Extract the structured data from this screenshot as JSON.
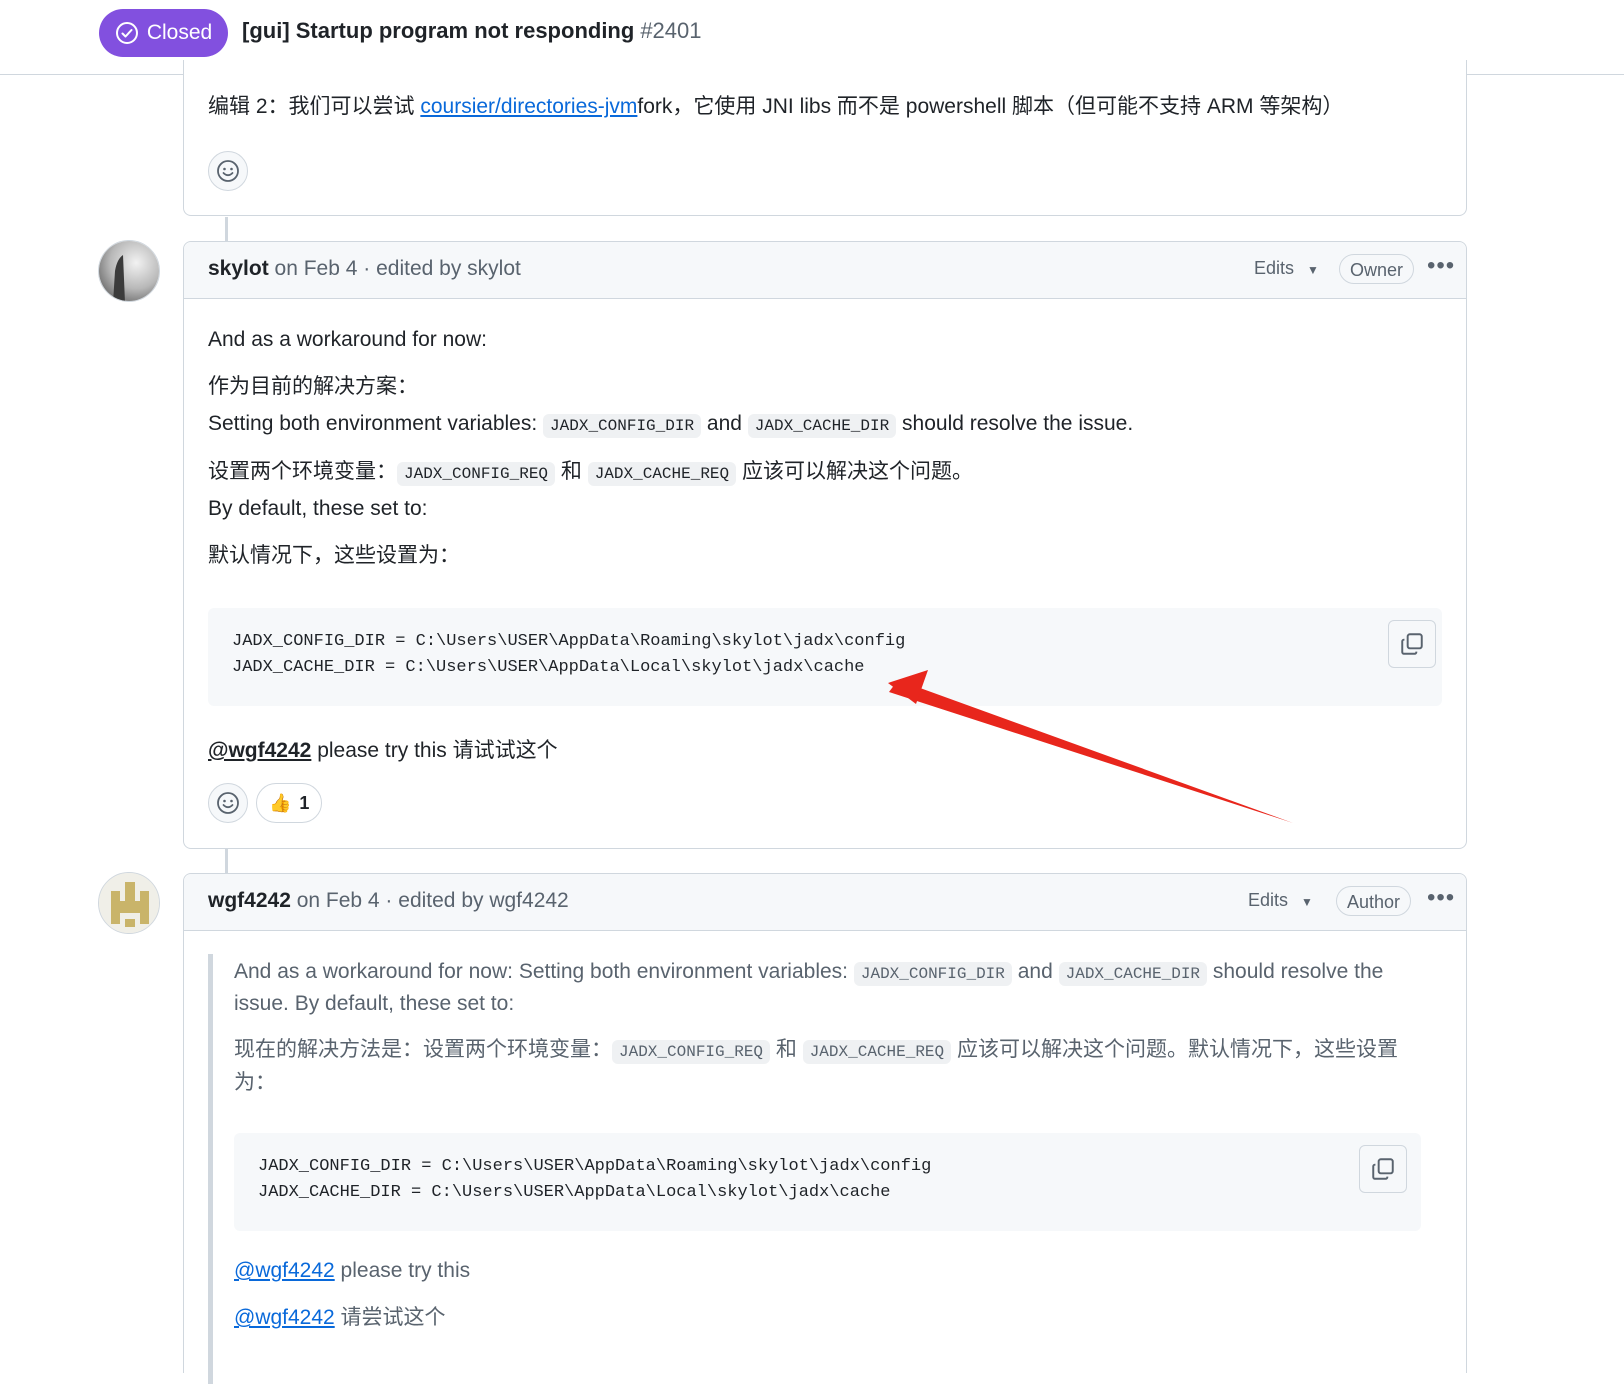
{
  "header": {
    "state_label": "Closed",
    "title": "[gui] Startup program not responding",
    "number": "#2401"
  },
  "comment1": {
    "line_prefix": "编辑 2：我们可以尝试 ",
    "link_text": "coursier/directories-jvm",
    "line_suffix": "fork，它使用 JNI libs 而不是 powershell 脚本（但可能不支持 ARM 等架构）"
  },
  "comment2": {
    "author": "skylot",
    "meta": " on Feb 4 · edited by skylot",
    "edits_label": "Edits",
    "role": "Owner",
    "p1": "And as a workaround for now:",
    "p2": "作为目前的解决方案：",
    "p3_a": "Setting both environment variables: ",
    "p3_code1": "JADX_CONFIG_DIR",
    "p3_b": " and ",
    "p3_code2": "JADX_CACHE_DIR",
    "p3_c": " should resolve the issue.",
    "p4_a": "设置两个环境变量：",
    "p4_code1": "JADX_CONFIG_REQ",
    "p4_b": " 和 ",
    "p4_code2": "JADX_CACHE_REQ",
    "p4_c": " 应该可以解决这个问题。",
    "p5": "By default, these set to:",
    "p6": "默认情况下，这些设置为：",
    "code_line1": "JADX_CONFIG_DIR = C:\\Users\\USER\\AppData\\Roaming\\skylot\\jadx\\config",
    "code_line2": "JADX_CACHE_DIR = C:\\Users\\USER\\AppData\\Local\\skylot\\jadx\\cache",
    "mention": "@wgf4242",
    "p7_suffix": " please try this  请试试这个",
    "reaction_count": "1"
  },
  "comment3": {
    "author": "wgf4242",
    "meta": " on Feb 4 · edited by wgf4242",
    "edits_label": "Edits",
    "role": "Author",
    "q1_a": "And as a workaround for now: Setting both environment variables: ",
    "q1_code1": "JADX_CONFIG_DIR",
    "q1_b": " and ",
    "q1_code2": "JADX_CACHE_DIR",
    "q1_c": " should resolve the",
    "q1_line2": "issue. By default, these set to:",
    "q2_a": "现在的解决方法是：设置两个环境变量：",
    "q2_code1": "JADX_CONFIG_REQ",
    "q2_b": " 和 ",
    "q2_code2": "JADX_CACHE_REQ",
    "q2_c": " 应该可以解决这个问题。默认情况下，这些设置",
    "q2_line2": "为：",
    "code_line1": "JADX_CONFIG_DIR = C:\\Users\\USER\\AppData\\Roaming\\skylot\\jadx\\config",
    "code_line2": "JADX_CACHE_DIR = C:\\Users\\USER\\AppData\\Local\\skylot\\jadx\\cache",
    "mention1": "@wgf4242",
    "m1_suffix": " please try this",
    "mention2": "@wgf4242",
    "m2_suffix": " 请尝试这个"
  },
  "colors": {
    "closed_purple": "#8250df",
    "link_blue": "#0969da",
    "annotation_arrow": "#e8261c"
  }
}
